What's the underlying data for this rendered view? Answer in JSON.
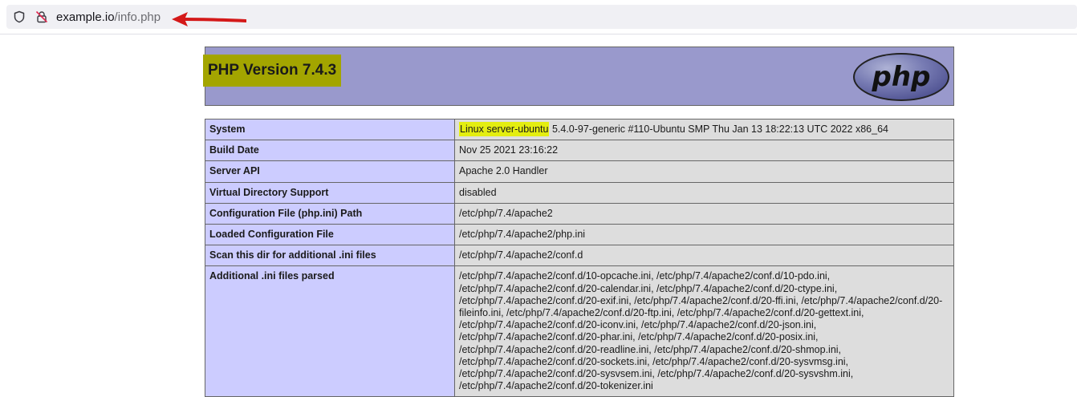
{
  "browser": {
    "url_host": "example.io",
    "url_path": "/info.php",
    "icons": [
      "shield-icon",
      "lock-icon"
    ],
    "annotation": "red-arrow-icon"
  },
  "header": {
    "version_title": "PHP Version 7.4.3",
    "logo_text": "php"
  },
  "system_value": {
    "highlight": "Linux server-ubuntu",
    "rest": " 5.4.0-97-generic #110-Ubuntu SMP Thu Jan 13 18:22:13 UTC 2022 x86_64"
  },
  "rows": [
    {
      "key": "System"
    },
    {
      "key": "Build Date",
      "value": "Nov 25 2021 23:16:22"
    },
    {
      "key": "Server API",
      "value": "Apache 2.0 Handler"
    },
    {
      "key": "Virtual Directory Support",
      "value": "disabled"
    },
    {
      "key": "Configuration File (php.ini) Path",
      "value": "/etc/php/7.4/apache2"
    },
    {
      "key": "Loaded Configuration File",
      "value": "/etc/php/7.4/apache2/php.ini"
    },
    {
      "key": "Scan this dir for additional .ini files",
      "value": "/etc/php/7.4/apache2/conf.d"
    },
    {
      "key": "Additional .ini files parsed",
      "value": "/etc/php/7.4/apache2/conf.d/10-opcache.ini, /etc/php/7.4/apache2/conf.d/10-pdo.ini, /etc/php/7.4/apache2/conf.d/20-calendar.ini, /etc/php/7.4/apache2/conf.d/20-ctype.ini, /etc/php/7.4/apache2/conf.d/20-exif.ini, /etc/php/7.4/apache2/conf.d/20-ffi.ini, /etc/php/7.4/apache2/conf.d/20-fileinfo.ini, /etc/php/7.4/apache2/conf.d/20-ftp.ini, /etc/php/7.4/apache2/conf.d/20-gettext.ini, /etc/php/7.4/apache2/conf.d/20-iconv.ini, /etc/php/7.4/apache2/conf.d/20-json.ini, /etc/php/7.4/apache2/conf.d/20-phar.ini, /etc/php/7.4/apache2/conf.d/20-posix.ini, /etc/php/7.4/apache2/conf.d/20-readline.ini, /etc/php/7.4/apache2/conf.d/20-shmop.ini, /etc/php/7.4/apache2/conf.d/20-sockets.ini, /etc/php/7.4/apache2/conf.d/20-sysvmsg.ini, /etc/php/7.4/apache2/conf.d/20-sysvsem.ini, /etc/php/7.4/apache2/conf.d/20-sysvshm.ini, /etc/php/7.4/apache2/conf.d/20-tokenizer.ini"
    }
  ]
}
